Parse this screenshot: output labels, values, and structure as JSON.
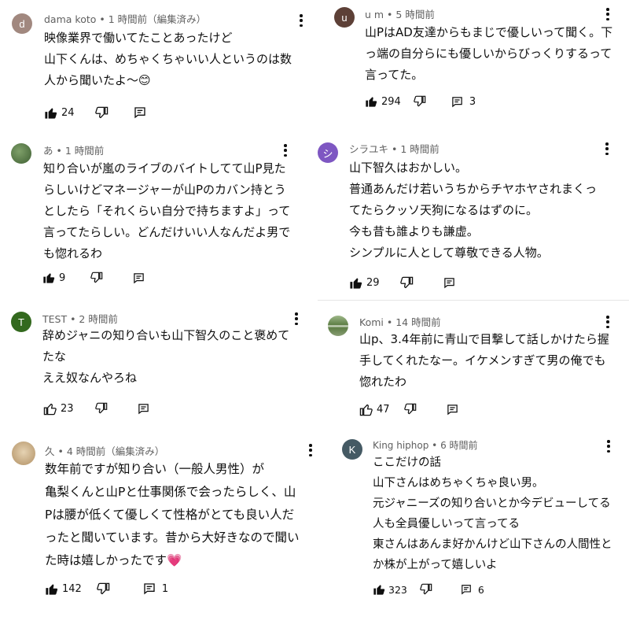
{
  "comments": [
    {
      "avatar_letter": "d",
      "avatar_color": "#a1887f",
      "meta": "dama koto • 1 時間前（編集済み）",
      "lines": [
        "映像業界で働いてたことあったけど",
        "山下くんは、めちゃくちゃいい人というのは数",
        "人から聞いたよ〜😊"
      ],
      "likes": "24",
      "replies": ""
    },
    {
      "avatar_letter": "",
      "avatar_color": "#4f7a3f",
      "meta": "あ • 1 時間前",
      "lines": [
        "知り合いが嵐のライブのバイトしてて山P見た",
        "らしいけどマネージャーが山Pのカバン持とう",
        "としたら「それくらい自分で持ちますよ」って",
        "言ってたらしい。どんだけいい人なんだよ男で",
        "も惚れるわ"
      ],
      "likes": "9",
      "replies": ""
    },
    {
      "avatar_letter": "T",
      "avatar_color": "#33691e",
      "meta": "TEST • 2 時間前",
      "lines": [
        "辞めジャニの知り合いも山下智久のこと褒めて",
        "たな",
        "ええ奴なんやろね"
      ],
      "likes": "23",
      "replies": ""
    },
    {
      "avatar_letter": "",
      "avatar_color": "#d9c7a8",
      "meta": "久 • 4 時間前（編集済み）",
      "lines": [
        "数年前ですが知り合い（一般人男性）が",
        "亀梨くんと山Pと仕事関係で会ったらしく、山",
        "Pは腰が低くて優しくて性格がとても良い人だ",
        "ったと聞いています。昔から大好きなので聞い",
        "た時は嬉しかったです💗"
      ],
      "likes": "142",
      "replies": "1"
    },
    {
      "avatar_letter": "u",
      "avatar_color": "#5d4037",
      "meta": "u m • 5 時間前",
      "lines": [
        "山PはAD友達からもまじで優しいって聞く。下",
        "っ端の自分らにも優しいからびっくりするって",
        "言ってた。"
      ],
      "likes": "294",
      "replies": "3"
    },
    {
      "avatar_letter": "シ",
      "avatar_color": "#7e57c2",
      "meta": "シラユキ • 1 時間前",
      "lines": [
        "山下智久はおかしい。",
        "普通あんだけ若いうちからチヤホヤされまくっ",
        "てたらクッソ天狗になるはずのに。",
        "今も昔も誰よりも謙虚。",
        "シンプルに人として尊敬できる人物。"
      ],
      "likes": "29",
      "replies": ""
    },
    {
      "avatar_letter": "",
      "avatar_color": "#6b8e4e",
      "meta": "Komi • 14 時間前",
      "lines": [
        "山p、3.4年前に青山で目撃して話しかけたら握",
        "手してくれたなー。イケメンすぎて男の俺でも",
        "惚れたわ"
      ],
      "likes": "47",
      "replies": ""
    },
    {
      "avatar_letter": "K",
      "avatar_color": "#455a64",
      "meta": "King hiphop • 6 時間前",
      "lines": [
        "ここだけの話",
        "山下さんはめちゃくちゃ良い男。",
        "元ジャニーズの知り合いとか今デビューしてる",
        "人も全員優しいって言ってる",
        "東さんはあんま好かんけど山下さんの人間性と",
        "か株が上がって嬉しいよ"
      ],
      "likes": "323",
      "replies": "6"
    }
  ]
}
